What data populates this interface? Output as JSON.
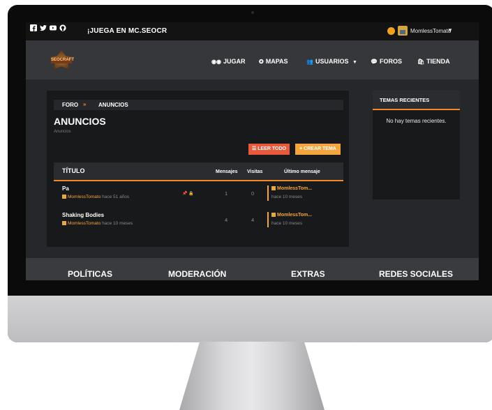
{
  "topbar": {
    "social_icons": [
      "facebook-icon",
      "twitter-icon",
      "youtube-icon",
      "github-icon"
    ],
    "announcement": "¡JUEGA EN MC.SEOCR",
    "username": "MomlessTomato",
    "user_caret": "▼"
  },
  "nav": {
    "logo_text": "SEOCRAFT",
    "items": [
      {
        "label": "JUGAR",
        "icon": "gamepad-icon",
        "glyph": "◉◉"
      },
      {
        "label": "MAPAS",
        "icon": "compass-icon",
        "glyph": "✪"
      },
      {
        "label": "USUARIOS",
        "icon": "users-icon",
        "glyph": "👥",
        "caret": "▼"
      },
      {
        "label": "FOROS",
        "icon": "comments-icon",
        "glyph": "💬"
      },
      {
        "label": "TIENDA",
        "icon": "shopping-bag-icon",
        "glyph": "🛍"
      }
    ]
  },
  "breadcrumb": {
    "home": "FORO",
    "separator": "»",
    "current": "ANUNCIOS"
  },
  "page": {
    "title": "ANUNCIOS",
    "subtitle": "Anuncios"
  },
  "buttons": {
    "read_all": "☰ LEER TODO",
    "create_topic": "+ CREAR TEMA"
  },
  "table": {
    "headers": {
      "title": "TÍTULO",
      "messages": "Mensajes",
      "views": "Visitas",
      "last": "Último mensaje"
    },
    "rows": [
      {
        "title": "Pa",
        "author": "MomlessTomato",
        "age": "hace 51 años",
        "icons": "📌 🔒",
        "messages": "1",
        "views": "0",
        "last_user": "MomlessTom...",
        "last_time": "hace 10 meses"
      },
      {
        "title": "Shaking Bodies",
        "author": "MomlessTomato",
        "age": "hace 10 meses",
        "icons": "",
        "messages": "4",
        "views": "4",
        "last_user": "MomlessTom...",
        "last_time": "hace 10 meses"
      }
    ]
  },
  "widget": {
    "title": "TEMAS RECIENTES",
    "empty": "No hay temas recientes."
  },
  "footer": {
    "sections": [
      "POLÍTICAS",
      "MODERACIÓN",
      "EXTRAS",
      "REDES SOCIALES"
    ]
  },
  "colors": {
    "accent": "#f08a29",
    "read_btn": "#e85a3b",
    "create_btn": "#f5a53d"
  }
}
